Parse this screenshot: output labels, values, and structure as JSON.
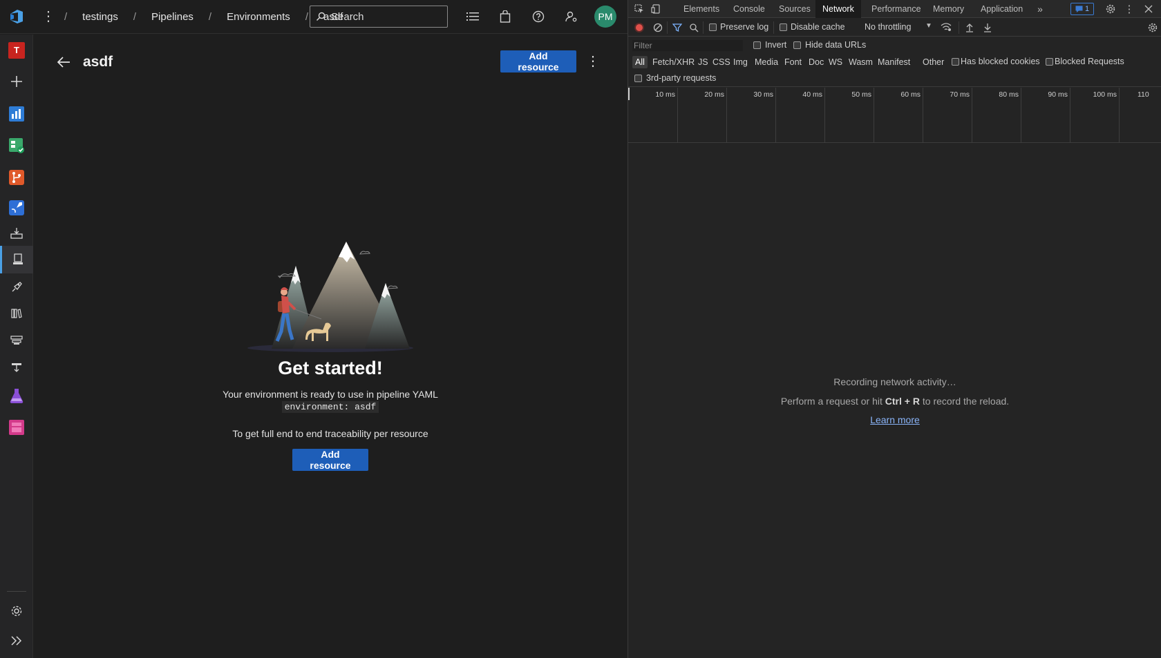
{
  "ado": {
    "breadcrumb": [
      "testings",
      "Pipelines",
      "Environments",
      "asdf"
    ],
    "search_placeholder": "Search",
    "avatar_initials": "PM",
    "project_initial": "T",
    "page_title": "asdf",
    "add_resource_label": "Add resource",
    "empty": {
      "title": "Get started!",
      "line1": "Your environment is ready to use in pipeline YAML",
      "code": "environment: asdf",
      "line2": "To get full end to end traceability per resource",
      "button": "Add resource"
    },
    "rail_icons": [
      "project-badge",
      "add-icon",
      "overview-icon",
      "boards-icon",
      "repos-icon",
      "pipelines-icon",
      "pipelines-builds-icon",
      "environments-icon",
      "releases-icon",
      "library-icon",
      "task-groups-icon",
      "deployment-groups-icon",
      "test-plans-icon",
      "artifacts-icon",
      "settings-icon",
      "expand-icon"
    ]
  },
  "devtools": {
    "tabs": [
      "Elements",
      "Console",
      "Sources",
      "Network",
      "Performance",
      "Memory",
      "Application"
    ],
    "selected_tab": "Network",
    "issues_count": "1",
    "toolbar": {
      "preserve_log": "Preserve log",
      "disable_cache": "Disable cache",
      "throttling": "No throttling"
    },
    "filter_placeholder": "Filter",
    "invert": "Invert",
    "hide_data_urls": "Hide data URLs",
    "types": [
      "All",
      "Fetch/XHR",
      "JS",
      "CSS",
      "Img",
      "Media",
      "Font",
      "Doc",
      "WS",
      "Wasm",
      "Manifest",
      "Other"
    ],
    "has_blocked_cookies": "Has blocked cookies",
    "blocked_requests": "Blocked Requests",
    "third_party": "3rd-party requests",
    "ticks": [
      "10 ms",
      "20 ms",
      "30 ms",
      "40 ms",
      "50 ms",
      "60 ms",
      "70 ms",
      "80 ms",
      "90 ms",
      "100 ms",
      "110"
    ],
    "status": {
      "recording": "Recording network activity…",
      "perform_pre": "Perform a request or hit ",
      "key_ctrl": "Ctrl",
      "plus": " + ",
      "key_r": "R",
      "perform_post": " to record the reload.",
      "learn_more": "Learn more"
    }
  }
}
